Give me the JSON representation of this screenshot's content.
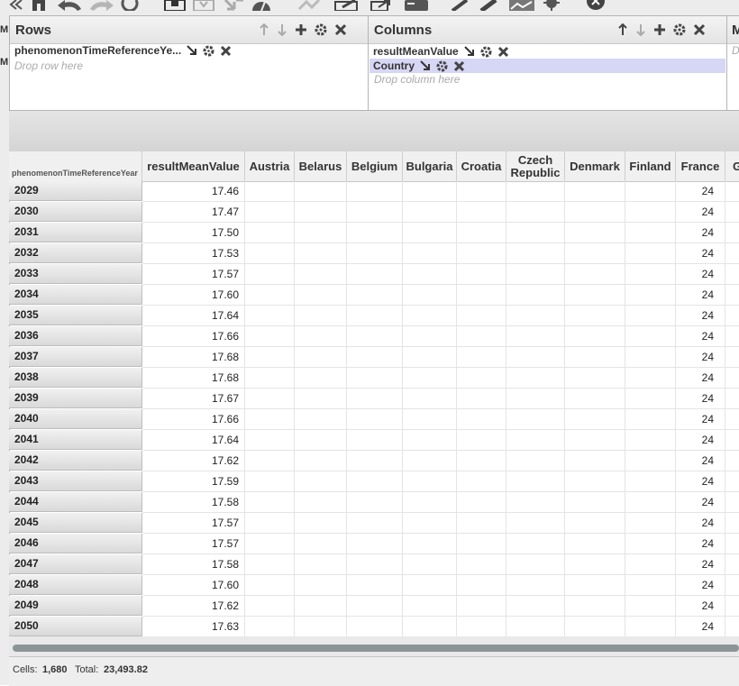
{
  "left_strip": {
    "fragments": [
      "M",
      "M"
    ]
  },
  "rows_zone": {
    "title": "Rows",
    "pill_label": "phenomenonTimeReferenceYe...",
    "placeholder": "Drop row here"
  },
  "columns_zone": {
    "title": "Columns",
    "pills": [
      {
        "label": "resultMeanValue",
        "selected": false
      },
      {
        "label": "Country",
        "selected": true
      }
    ],
    "placeholder": "Drop column here"
  },
  "measures_zone": {
    "title": "M",
    "placeholder": "D"
  },
  "table": {
    "row_header": "phenomenonTimeReferenceYear",
    "columns": [
      "resultMeanValue",
      "Austria",
      "Belarus",
      "Belgium",
      "Bulgaria",
      "Croatia",
      "Czech\nRepublic",
      "Denmark",
      "Finland",
      "France",
      "Ge"
    ],
    "rows": [
      {
        "year": "2029",
        "mean": "17.46",
        "france": "24"
      },
      {
        "year": "2030",
        "mean": "17.47",
        "france": "24"
      },
      {
        "year": "2031",
        "mean": "17.50",
        "france": "24"
      },
      {
        "year": "2032",
        "mean": "17.53",
        "france": "24"
      },
      {
        "year": "2033",
        "mean": "17.57",
        "france": "24"
      },
      {
        "year": "2034",
        "mean": "17.60",
        "france": "24"
      },
      {
        "year": "2035",
        "mean": "17.64",
        "france": "24"
      },
      {
        "year": "2036",
        "mean": "17.66",
        "france": "24"
      },
      {
        "year": "2037",
        "mean": "17.68",
        "france": "24"
      },
      {
        "year": "2038",
        "mean": "17.68",
        "france": "24"
      },
      {
        "year": "2039",
        "mean": "17.67",
        "france": "24"
      },
      {
        "year": "2040",
        "mean": "17.66",
        "france": "24"
      },
      {
        "year": "2041",
        "mean": "17.64",
        "france": "24"
      },
      {
        "year": "2042",
        "mean": "17.62",
        "france": "24"
      },
      {
        "year": "2043",
        "mean": "17.59",
        "france": "24"
      },
      {
        "year": "2044",
        "mean": "17.58",
        "france": "24"
      },
      {
        "year": "2045",
        "mean": "17.57",
        "france": "24"
      },
      {
        "year": "2046",
        "mean": "17.57",
        "france": "24"
      },
      {
        "year": "2047",
        "mean": "17.58",
        "france": "24"
      },
      {
        "year": "2048",
        "mean": "17.60",
        "france": "24"
      },
      {
        "year": "2049",
        "mean": "17.62",
        "france": "24"
      },
      {
        "year": "2050",
        "mean": "17.63",
        "france": "24"
      }
    ]
  },
  "status": {
    "cells_label": "Cells:",
    "cells_value": "1,680",
    "total_label": "Total:",
    "total_value": "23,493.82"
  },
  "colors": {
    "selected_pill": "#d6d6f5",
    "scroll_track": "#8c9497"
  }
}
